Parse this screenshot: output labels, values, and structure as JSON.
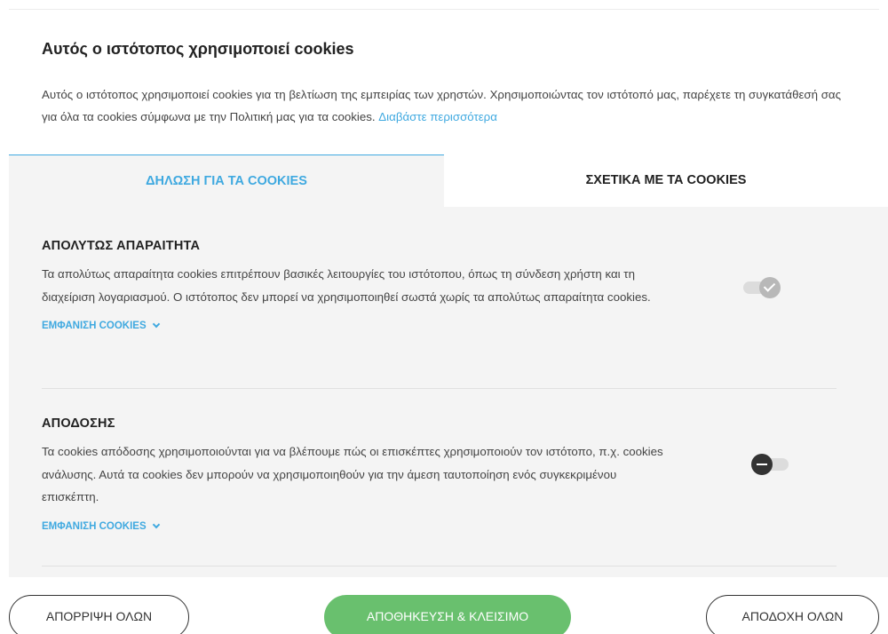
{
  "banner": {
    "title": "Αυτός ο ιστότοπος χρησιμοποιεί cookies",
    "text": "Αυτός ο ιστότοπος χρησιμοποιεί cookies για τη βελτίωση της εμπειρίας των χρηστών. Χρησιμοποιώντας τον ιστότοπό μας, παρέχετε τη συγκατάθεσή σας για όλα τα cookies σύμφωνα με την Πολιτική μας για τα cookies.",
    "read_more": "Διαβάστε περισσότερα"
  },
  "tabs": [
    {
      "label": "ΔΗΛΩΣΗ ΓΙΑ ΤΑ COOKIES",
      "active": true
    },
    {
      "label": "ΣΧΕΤΙΚΑ ΜΕ ΤΑ COOKIES",
      "active": false
    }
  ],
  "sections": [
    {
      "title": "ΑΠΟΛΥΤΩΣ ΑΠΑΡΑΙΤΗΤΑ",
      "description": "Τα απολύτως απαραίτητα cookies επιτρέπουν βασικές λειτουργίες του ιστότοπου, όπως τη σύνδεση χρήστη και τη διαχείριση λογαριασμού. Ο ιστότοπος δεν μπορεί να χρησιμοποιηθεί σωστά χωρίς τα απολύτως απαραίτητα cookies.",
      "show_cookies": "ΕΜΦΑΝΙΣΗ COOKIES",
      "toggle_state": "on"
    },
    {
      "title": "ΑΠΟΔΟΣΗΣ",
      "description": "Τα cookies απόδοσης χρησιμοποιούνται για να βλέπουμε πώς οι επισκέπτες χρησιμοποιούν τον ιστότοπο, π.χ. cookies ανάλυσης. Αυτά τα cookies δεν μπορούν να χρησιμοποιηθούν για την άμεση ταυτοποίηση ενός συγκεκριμένου επισκέπτη.",
      "show_cookies": "ΕΜΦΑΝΙΣΗ COOKIES",
      "toggle_state": "off"
    }
  ],
  "footer": {
    "reject_all": "ΑΠΟΡΡΙΨΗ ΟΛΩΝ",
    "save_close": "ΑΠΟΘΗΚΕΥΣΗ & ΚΛΕΙΣΙΜΟ",
    "accept_all": "ΑΠΟΔΟΧΗ ΟΛΩΝ"
  },
  "colors": {
    "accent": "#3fa9e0",
    "save_button": "#69c06e",
    "panel_bg": "#f4f4f4"
  },
  "icons": {
    "toggle_on": "checkmark-icon",
    "toggle_off": "minus-icon",
    "expand": "chevron-down-icon"
  }
}
